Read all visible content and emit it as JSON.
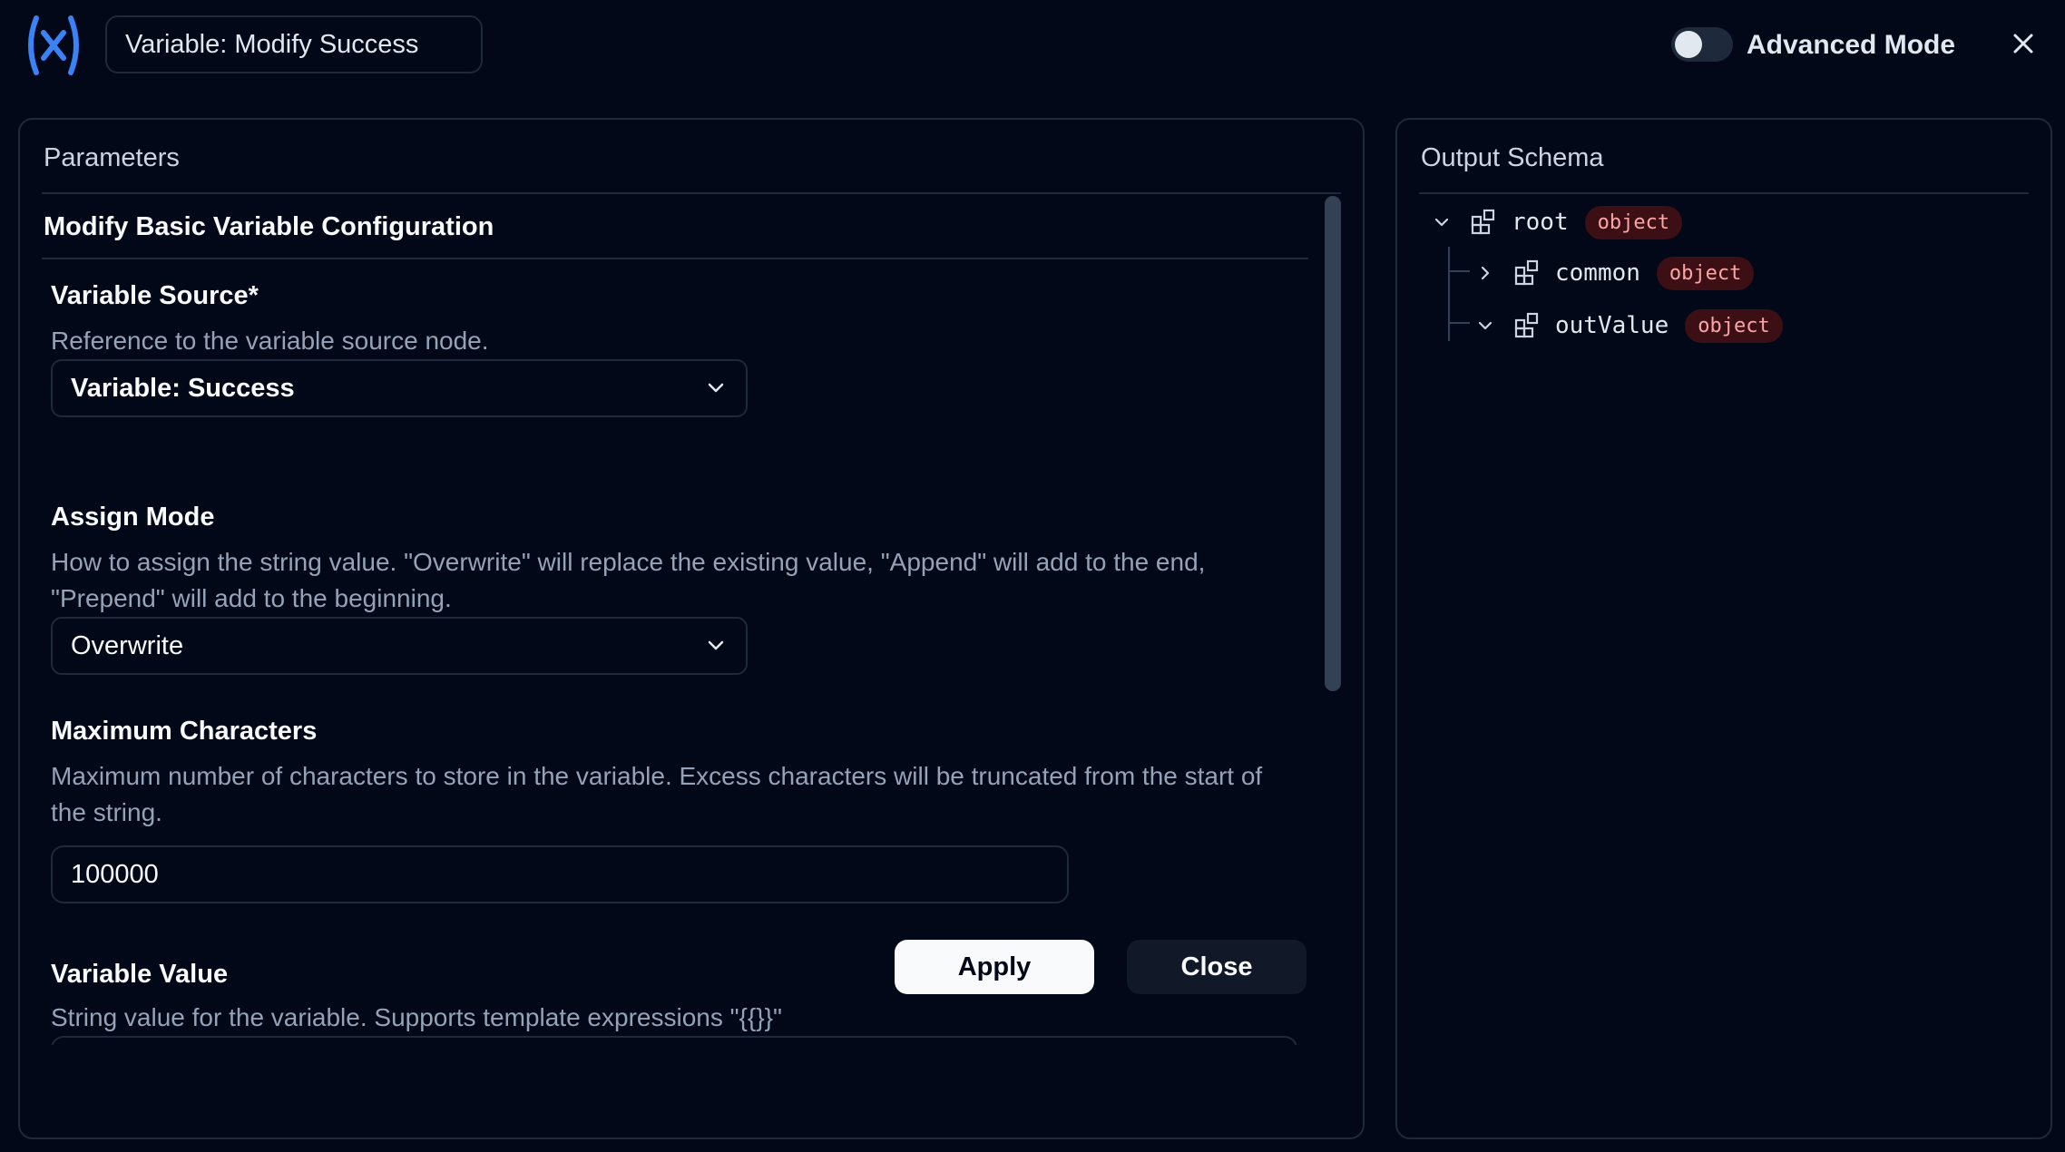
{
  "header": {
    "node_title": "Variable: Modify Success",
    "advanced_mode_label": "Advanced Mode",
    "advanced_mode_on": false
  },
  "parameters": {
    "title": "Parameters",
    "section_title": "Modify Basic Variable Configuration",
    "variable_source": {
      "label": "Variable Source*",
      "description": "Reference to the variable source node.",
      "value": "Variable: Success"
    },
    "assign_mode": {
      "label": "Assign Mode",
      "description": "How to assign the string value. \"Overwrite\" will replace the existing value, \"Append\" will add to the end, \"Prepend\" will add to the beginning.",
      "value": "Overwrite"
    },
    "max_chars": {
      "label": "Maximum Characters",
      "description": "Maximum number of characters to store in the variable. Excess characters will be truncated from the start of the string.",
      "value": "100000"
    },
    "variable_value": {
      "label": "Variable Value",
      "description": "String value for the variable. Supports template expressions \"{{}}\""
    },
    "apply_label": "Apply",
    "close_label": "Close"
  },
  "output_schema": {
    "title": "Output Schema",
    "root": {
      "key": "root",
      "type": "object",
      "expanded": true
    },
    "children": [
      {
        "key": "common",
        "type": "object",
        "expanded": false
      },
      {
        "key": "outValue",
        "type": "object",
        "expanded": true
      }
    ]
  },
  "colors": {
    "background": "#020817",
    "border": "#1e293b",
    "accent_logo": "#3b82f6",
    "badge_text": "#fca5a5",
    "badge_bg": "#3b0f14"
  }
}
